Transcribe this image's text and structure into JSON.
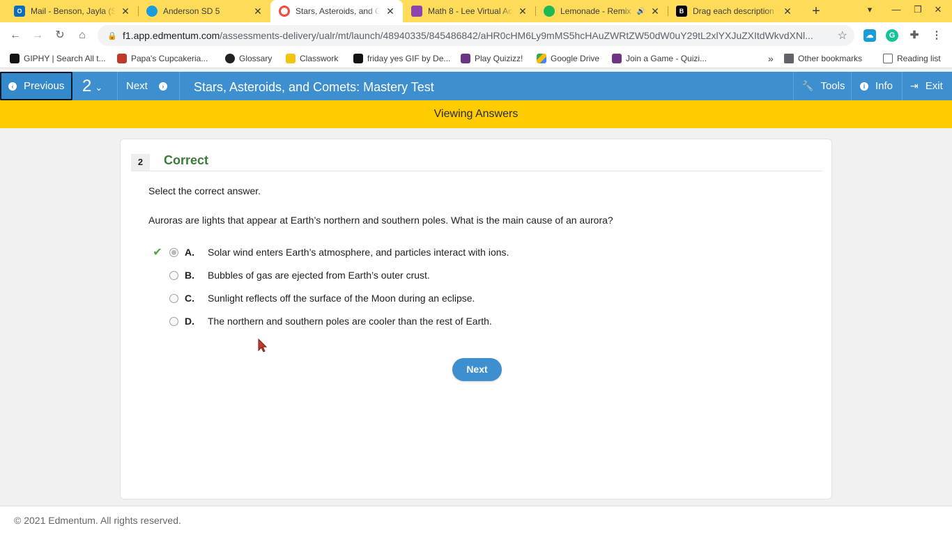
{
  "browser": {
    "tabs": [
      {
        "title": "Mail - Benson, Jayla (St",
        "icon": "outlook-icon",
        "color": "#0f6cbd"
      },
      {
        "title": "Anderson SD 5",
        "icon": "cloud-icon",
        "color": "#1a9cd8"
      },
      {
        "title": "Stars, Asteroids, and Co",
        "icon": "edmentum-icon",
        "color": "#e84c3d",
        "active": true
      },
      {
        "title": "Math 8 - Lee Virtual Aca",
        "icon": "classroom-icon",
        "color": "#8e44ad"
      },
      {
        "title": "Lemonade - Remix",
        "icon": "spotify-icon",
        "color": "#1db954"
      },
      {
        "title": "Drag each description t",
        "icon": "brainly-icon",
        "color": "#000000"
      }
    ],
    "new_tab": "+",
    "url_host": "f1.app.edmentum.com",
    "url_path": "/assessments-delivery/ualr/mt/launch/48940335/845486842/aHR0cHM6Ly9mMS5hcHAuZWRtZW50dW0uY29tL2xlYXJuZXItdWkvdXNl...",
    "bookmarks": [
      {
        "label": "GIPHY | Search All t...",
        "color": "#121212"
      },
      {
        "label": "Papa's Cupcakeria...",
        "color": "#c0392b"
      },
      {
        "label": "Glossary",
        "color": "#222222"
      },
      {
        "label": "Classwork",
        "color": "#f1c40f"
      },
      {
        "label": "friday yes GIF by De...",
        "color": "#121212"
      },
      {
        "label": "Play Quizizz!",
        "color": "#6c3483"
      },
      {
        "label": "Google Drive",
        "color": "#34a853"
      },
      {
        "label": "Join a Game - Quizi...",
        "color": "#6c3483"
      }
    ],
    "more_bookmarks": "»",
    "other_bookmarks": "Other bookmarks",
    "reading_list": "Reading list"
  },
  "header": {
    "previous": "Previous",
    "question_selector": "2",
    "next": "Next",
    "title": "Stars, Asteroids, and Comets: Mastery Test",
    "tools": "Tools",
    "info": "Info",
    "exit": "Exit"
  },
  "banner": "Viewing Answers",
  "question": {
    "number": "2",
    "status": "Correct",
    "instruction": "Select the correct answer.",
    "prompt": "Auroras are lights that appear at Earth’s northern and southern poles. What is the main cause of an aurora?",
    "options": [
      {
        "letter": "A.",
        "text": "Solar wind enters Earth’s atmosphere, and particles interact with ions.",
        "selected": true,
        "correct": true
      },
      {
        "letter": "B.",
        "text": "Bubbles of gas are ejected from Earth’s outer crust.",
        "selected": false
      },
      {
        "letter": "C.",
        "text": "Sunlight reflects off the surface of the Moon during an eclipse.",
        "selected": false
      },
      {
        "letter": "D.",
        "text": "The northern and southern poles are cooler than the rest of Earth.",
        "selected": false
      }
    ],
    "next_button": "Next"
  },
  "footer": "© 2021 Edmentum. All rights reserved.",
  "colors": {
    "tabstrip": "#fedc5a",
    "header_blue": "#3d8fd0",
    "banner_yellow": "#fecc00",
    "correct_green": "#3b7a3b"
  }
}
